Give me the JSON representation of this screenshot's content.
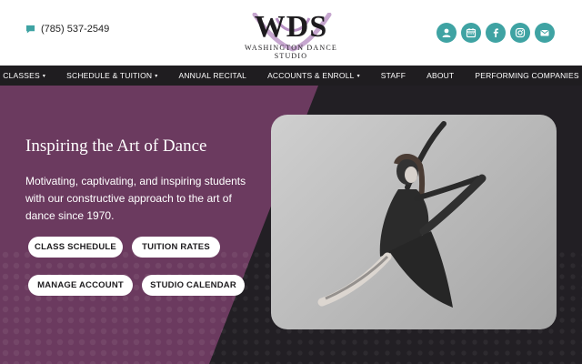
{
  "header": {
    "phone": "(785) 537-2549",
    "logo": {
      "letters": "WDS",
      "tagline": "WASHINGTON DANCE STUDIO"
    },
    "socials": [
      {
        "icon": "user-icon"
      },
      {
        "icon": "calendar-icon"
      },
      {
        "icon": "facebook-icon"
      },
      {
        "icon": "instagram-icon"
      },
      {
        "icon": "email-icon"
      }
    ]
  },
  "nav": {
    "items": [
      {
        "label": "CLASSES",
        "dropdown": true
      },
      {
        "label": "SCHEDULE & TUITION",
        "dropdown": true
      },
      {
        "label": "ANNUAL RECITAL",
        "dropdown": false
      },
      {
        "label": "ACCOUNTS & ENROLL",
        "dropdown": true
      },
      {
        "label": "STAFF",
        "dropdown": false
      },
      {
        "label": "ABOUT",
        "dropdown": false
      },
      {
        "label": "PERFORMING COMPANIES",
        "dropdown": false
      }
    ]
  },
  "hero": {
    "headline": "Inspiring the Art of Dance",
    "subtext": "Motivating, captivating, and inspiring students with our constructive approach to the art of dance since 1970.",
    "buttons": {
      "class_schedule": "CLASS SCHEDULE",
      "tuition_rates": "TUITION RATES",
      "manage_account": "MANAGE ACCOUNT",
      "studio_calendar": "STUDIO CALENDAR"
    }
  },
  "colors": {
    "accent_teal": "#3fa3a3",
    "purple": "#6b3a5f",
    "dark": "#1f1d20"
  }
}
